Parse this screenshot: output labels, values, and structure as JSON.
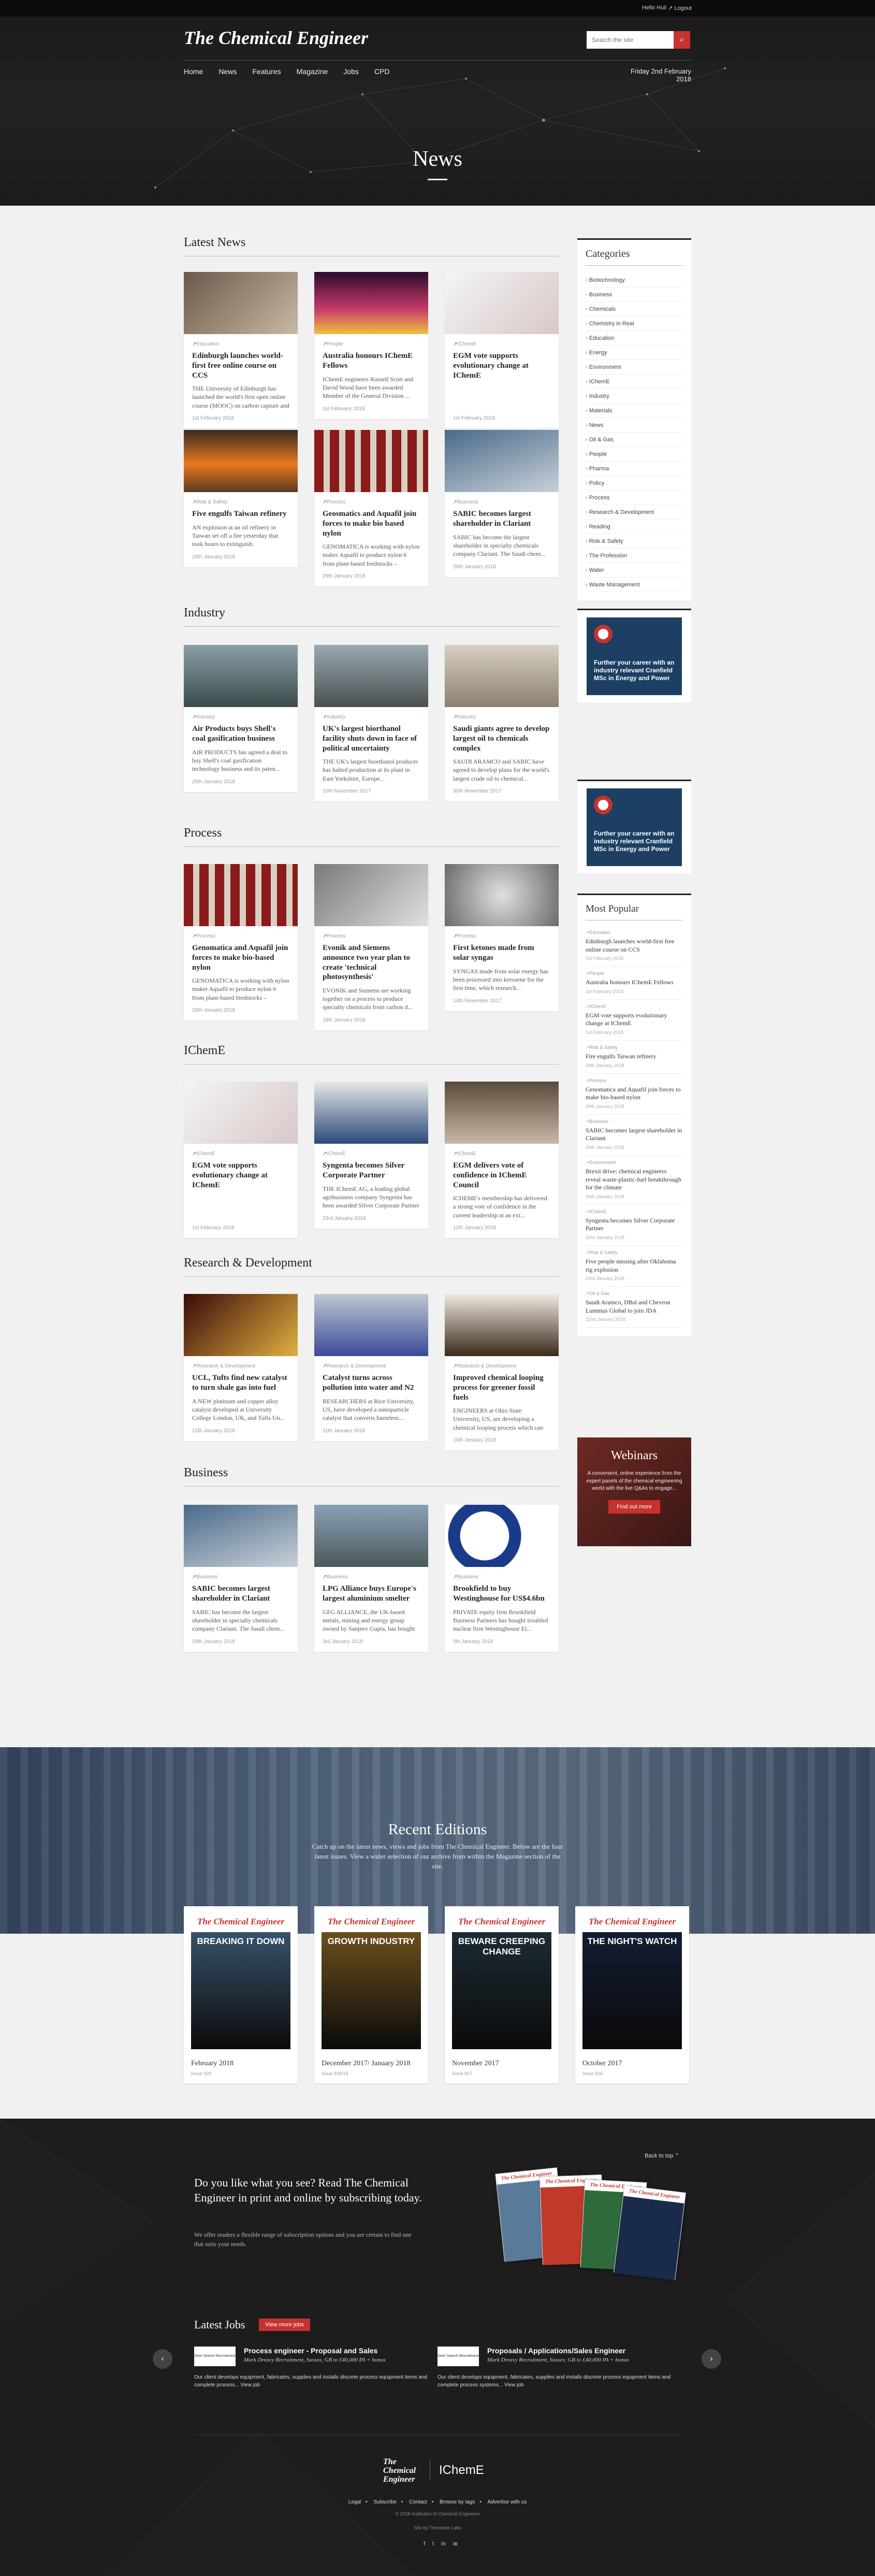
{
  "topbar": {
    "user": "Hello Huil",
    "logout": "Logout"
  },
  "header": {
    "logo": "The Chemical Engineer",
    "search_placeholder": "Search the site",
    "nav": [
      "Home",
      "News",
      "Features",
      "Magazine",
      "Jobs",
      "CPD"
    ],
    "date": "Friday 2nd February 2018",
    "page_title": "News"
  },
  "sections": {
    "latest": {
      "title": "Latest News",
      "cards": [
        {
          "cat": "Education",
          "title": "Edinburgh launches world-first free online course on CCS",
          "summary": "THE University of Edinburgh has launched the world's first open online course (MOOC) on carbon capture and st...",
          "date": "1st February 2018"
        },
        {
          "cat": "People",
          "title": "Australia honours IChemE Fellows",
          "summary": "IChemE engineers Russell Scott and David Wood have been awarded Member of the General Division ...",
          "date": "1st February 2018"
        },
        {
          "cat": "IChemE",
          "title": "EGM vote supports evolutionary change at IChemE",
          "summary": "",
          "date": "1st February 2018"
        },
        {
          "cat": "Risk & Safety",
          "title": "Five engulfs Taiwan refinery",
          "summary": "AN explosion at an oil refinery in Taiwan set off a fire yesterday that took hours to extinguish.",
          "date": "29th January 2018"
        },
        {
          "cat": "Process",
          "title": "Geosmatics and Aquafil join forces to make bio based nylon",
          "summary": "GENOMATICA is working with nylon maker Aquafil to produce nylon 6 from plant-based feedstocks – significant...",
          "date": "29th January 2018"
        },
        {
          "cat": "Business",
          "title": "SABIC becomes largest shareholder in Clariant",
          "summary": "SABIC has become the largest shareholder in specialty chemicals company Clariant. The Saudi chem...",
          "date": "29th January 2018"
        }
      ]
    },
    "industry": {
      "title": "Industry",
      "cards": [
        {
          "cat": "Industry",
          "title": "Air Products buys Shell's coal gasification business",
          "summary": "AIR PRODUCTS has agreed a deal to buy Shell's coal gasification technology business and its paten...",
          "date": "25th January 2018"
        },
        {
          "cat": "Industry",
          "title": "UK's largest biorthanol facility shuts down in face of political uncertainty",
          "summary": "THE UK's largest bioethanol producer has halted production at its plant in East Yorkshire, Europe...",
          "date": "10th November 2017"
        },
        {
          "cat": "Industry",
          "title": "Saudi giants agree to develop largest oil to chemicals complex",
          "summary": "SAUDI ARAMCO and SABIC have agreed to develop plans for the world's largest crude oil to chemical...",
          "date": "30th November 2017"
        }
      ]
    },
    "process": {
      "title": "Process",
      "cards": [
        {
          "cat": "Process",
          "title": "Genomatica and Aquafil join forces to make bio-based nylon",
          "summary": "GENOMATICA is working with nylon maker Aquafil to produce nylon 6 from plant-based feedstocks – significant...",
          "date": "29th January 2018"
        },
        {
          "cat": "Process",
          "title": "Evonik and Siemens announce two year plan to create 'technical photosynthesis'",
          "summary": "EVONIK and Siemens are working together on a process to produce specialty chemicals from carbon d...",
          "date": "18th January 2018"
        },
        {
          "cat": "Process",
          "title": "First ketones made from solar syngas",
          "summary": "SYNGAS made from solar energy has been processed into kerosene for the first time, which research...",
          "date": "14th November 2017"
        }
      ]
    },
    "icheme": {
      "title": "IChemE",
      "cards": [
        {
          "cat": "IChemE",
          "title": "EGM vote supports evolutionary change at IChemE",
          "summary": "",
          "date": "1st February 2018"
        },
        {
          "cat": "IChemE",
          "title": "Syngenta becomes Silver Corporate Partner",
          "summary": "THE IChemE AG, a leading global agribusiness company Syngenta has been awarded Silver Corporate Partner stat...",
          "date": "23rd January 2018"
        },
        {
          "cat": "IChemE",
          "title": "EGM delivers vote of confidence in IChemE Council",
          "summary": "ICHEME's membership has delivered a strong vote of confidence in the current leadership at an ext...",
          "date": "12th January 2018"
        }
      ]
    },
    "research": {
      "title": "Research & Development",
      "cards": [
        {
          "cat": "Research & Development",
          "title": "UCL, Tufts find new catalyst to turn shale gas into fuel",
          "summary": "A NEW platinum and copper alloy catalyst developed at University College London, UK, and Tufts Un...",
          "date": "12th January 2018"
        },
        {
          "cat": "Research & Development",
          "title": "Catalyst turns across pollution into water and N2",
          "summary": "RESEARCHERS at Rice University, US, have developed a nanoparticle catalyst that converts harmless...",
          "date": "11th January 2018"
        },
        {
          "cat": "Research & Development",
          "title": "Improved chemical looping process for greener fossil fuels",
          "summary": "ENGINEERS at Ohio State University, US, are developing a chemical looping process which can resul...",
          "date": "10th January 2018"
        }
      ]
    },
    "business": {
      "title": "Business",
      "cards": [
        {
          "cat": "Business",
          "title": "SABIC becomes largest shareholder in Clariant",
          "summary": "SABIC has become the largest shareholder in specialty chemicals company Clariant. The Saudi chem...",
          "date": "29th January 2018"
        },
        {
          "cat": "Business",
          "title": "LPG Alliance buys Europe's largest aluminium smelter",
          "summary": "GFG ALLIANCE, the UK-based metals, mining and energy group owned by Sanjeev Gupta, has bought Eur...",
          "date": "3rd January 2018"
        },
        {
          "cat": "Business",
          "title": "Brookfield to buy Westinghouse for US$4.6bn",
          "summary": "PRIVATE equity firm Brookfield Business Partners has bought troubled nuclear firm Westinghouse El...",
          "date": "5th January 2018"
        }
      ]
    }
  },
  "sidebar": {
    "categories_title": "Categories",
    "categories": [
      "Biotechnology",
      "Business",
      "Chemicals",
      "Chemistry in Real",
      "Education",
      "Energy",
      "Environment",
      "IChemE",
      "Industry",
      "Materials",
      "News",
      "Oil & Gas",
      "People",
      "Pharma",
      "Policy",
      "Process",
      "Research & Development",
      "Reading",
      "Risk & Safety",
      "The Profession",
      "Water",
      "Waste Management"
    ],
    "ad_text": "Further your career with an industry relevant Cranfield MSc in Energy and Power",
    "popular_title": "Most Popular",
    "popular": [
      {
        "cat": "Education",
        "title": "Edinburgh launches world-first free online course on CCS",
        "date": "1st February 2018"
      },
      {
        "cat": "People",
        "title": "Australia honours IChemE Fellows",
        "date": "1st February 2018"
      },
      {
        "cat": "IChemE",
        "title": "EGM vote supports evolutionary change at IChemE",
        "date": "1st February 2018"
      },
      {
        "cat": "Risk & Safety",
        "title": "Fire engulfs Taiwan refinery",
        "date": "29th January 2018"
      },
      {
        "cat": "Process",
        "title": "Genomatica and Aquafil join forces to make bio-based nylon",
        "date": "29th January 2018"
      },
      {
        "cat": "Business",
        "title": "SABIC becomes largest shareholder in Clariant",
        "date": "29th January 2018"
      },
      {
        "cat": "Environment",
        "title": "Brexit drive: chemical engineers reveal waste-plastic-fuel breakthrough for the climate",
        "date": "26th January 2018"
      },
      {
        "cat": "IChemE",
        "title": "Syngenta becomes Silver Corporate Partner",
        "date": "23rd January 2018"
      },
      {
        "cat": "Risk & Safety",
        "title": "Five people missing after Oklahoma rig explosion",
        "date": "23rd January 2018"
      },
      {
        "cat": "Oil & Gas",
        "title": "Saudi Aramco, DBsl and Chevron Lummus Global to join JDA",
        "date": "22nd January 2018"
      }
    ],
    "webinar_title": "Webinars",
    "webinar_text": "A convenient, online experience from the expert panels of the chemical engineering world with the live Q&As to engage...",
    "webinar_button": "Find out more"
  },
  "recent": {
    "title": "Recent Editions",
    "subtitle": "Catch up on the latest news, views and jobs from The Chemical Engineer. Below are the four latest issues. View a wider selection of our archive from within the Magazine section of the site.",
    "mags": [
      {
        "headline": "BREAKING IT DOWN",
        "title": "February 2018",
        "issue": "Issue 920",
        "color": "#3f5d7a"
      },
      {
        "headline": "GROWTH INDUSTRY",
        "title": "December 2017/ January 2018",
        "issue": "Issue 918/19",
        "color": "#7a5a20"
      },
      {
        "headline": "BEWARE CREEPING CHANGE",
        "title": "November 2017",
        "issue": "Issue 917",
        "color": "#20303a"
      },
      {
        "headline": "THE NIGHT'S WATCH",
        "title": "October 2017",
        "issue": "Issue 916",
        "color": "#14203a"
      }
    ]
  },
  "footer": {
    "back_to_top": "Back to top",
    "subscribe_heading": "Do you like what you see? Read The Chemical Engineer in print and online by subscribing today.",
    "subscribe_small": "We offer readers a flexible range of subscription options and you are certain to find one that suits your needs.",
    "jobs_title": "Latest Jobs",
    "jobs_button": "View more jobs",
    "jobs": [
      {
        "logo": "Deer Search Recruitment",
        "title": "Process engineer - Proposal and Sales",
        "company": "Mark Dreavy Recruitment, Sussex, GB to £40,000 PA + bonus",
        "desc": "Our client develops equipment, fabricates, supplies and installs discrete process equipment items and complete process... View job"
      },
      {
        "logo": "Deer Search Recruitment",
        "title": "Proposals / Applications/Sales Engineer",
        "company": "Mark Dreavy Recruitment, Sussex, GB to £40,000 PA + bonus",
        "desc": "Our client develops equipment, fabricates, supplies and installs discrete process equipment items and complete process systems... View job"
      }
    ],
    "logo1": "The Chemical Engineer",
    "logo2": "IChemE",
    "links": [
      "Legal",
      "Subscribe",
      "Contact",
      "Browse by tags",
      "Advertise with us"
    ],
    "copyright": "© 2018 Institution of Chemical Engineers",
    "site_by": "Site by Trimstone Labs",
    "social": [
      "f",
      "t",
      "in",
      "✉"
    ]
  }
}
